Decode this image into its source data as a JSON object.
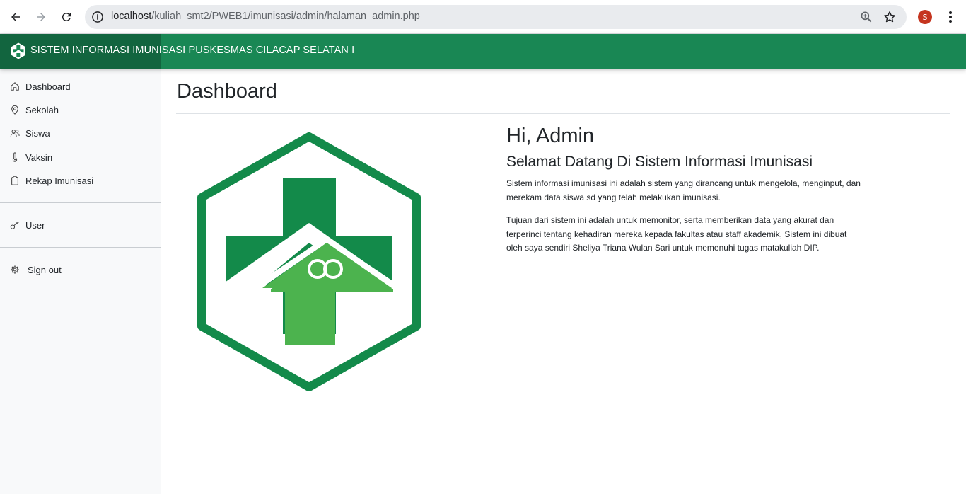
{
  "browser": {
    "url_host": "localhost",
    "url_path": "/kuliah_smt2/PWEB1/imunisasi/admin/halaman_admin.php",
    "profile_initial": "S"
  },
  "header": {
    "title": "SISTEM INFORMASI IMUNISASI PUSKESMAS CILACAP SELATAN I"
  },
  "sidebar": {
    "items": [
      {
        "label": "Dashboard",
        "icon": "home-icon"
      },
      {
        "label": "Sekolah",
        "icon": "map-pin-icon"
      },
      {
        "label": "Siswa",
        "icon": "people-icon"
      },
      {
        "label": "Vaksin",
        "icon": "thermometer-icon"
      },
      {
        "label": "Rekap Imunisasi",
        "icon": "clipboard-icon"
      }
    ],
    "user_label": "User",
    "signout_label": "Sign out"
  },
  "main": {
    "page_title": "Dashboard",
    "greeting": "Hi, Admin",
    "welcome": "Selamat Datang Di Sistem Informasi Imunisasi",
    "paragraph1_line1": "Sistem informasi imunisasi ini adalah sistem yang dirancang untuk mengelola, menginput, dan",
    "paragraph1_line2": "merekam data siswa sd yang telah melakukan imunisasi.",
    "paragraph2_line1": "Tujuan dari sistem ini adalah untuk memonitor, serta memberikan data yang akurat dan",
    "paragraph2_line2": "terperinci tentang kehadiran mereka kepada fakultas atau staff akademik, Sistem ini dibuat",
    "paragraph2_line3": "oleh saya sendiri Sheliya Triana Wulan Sari untuk memenuhi tugas matakuliah DIP."
  },
  "colors": {
    "brand_green": "#198754",
    "logo_dark_green": "#138a4a",
    "logo_light_green": "#4cb34e"
  }
}
